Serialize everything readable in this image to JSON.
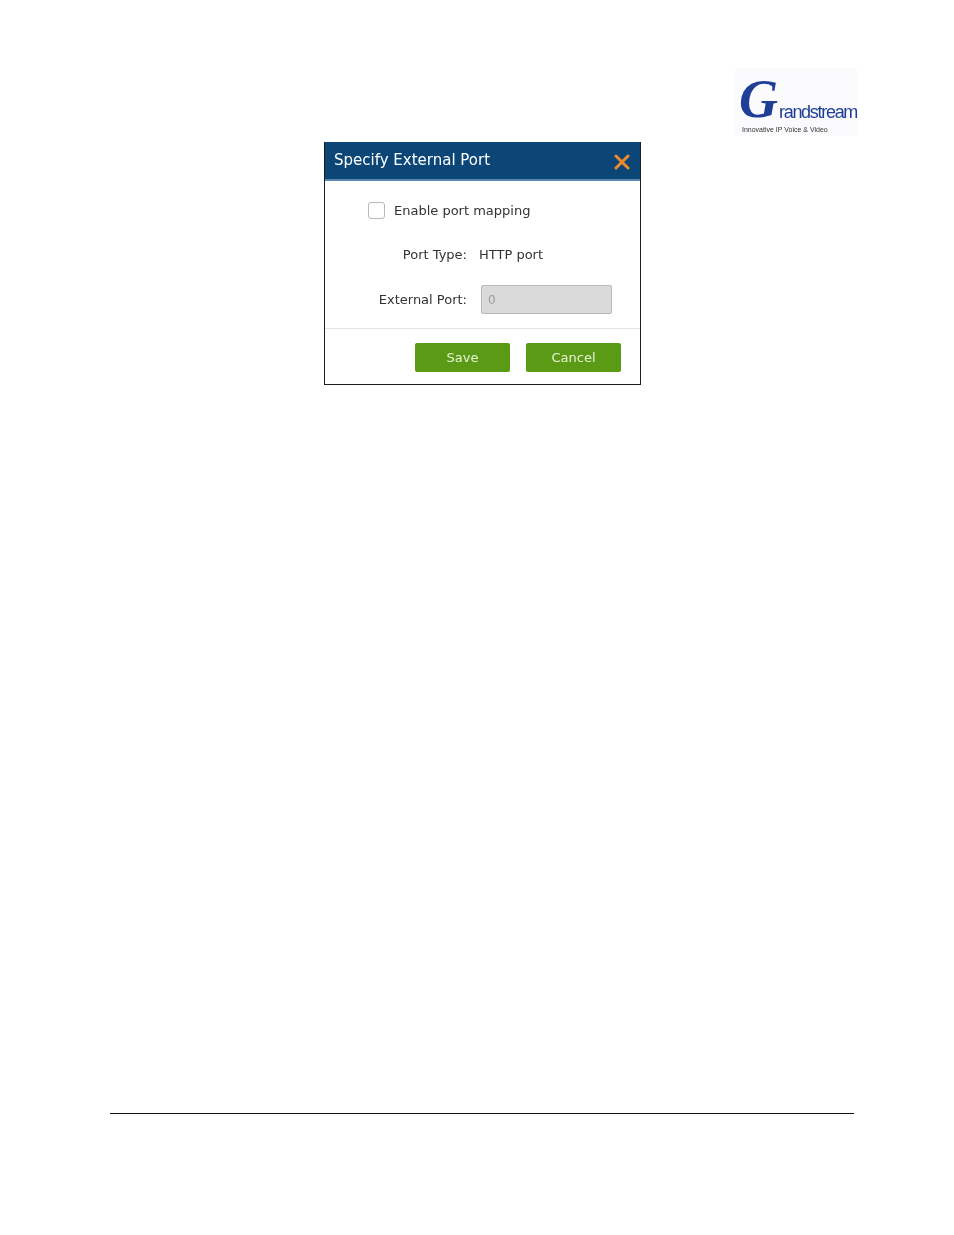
{
  "logo": {
    "initial": "G",
    "name": "randstream",
    "tagline": "Innovative IP Voice & Video"
  },
  "dialog": {
    "title": "Specify External Port",
    "enable_port_mapping": {
      "label": "Enable port mapping",
      "checked": false
    },
    "fields": [
      {
        "kind": "text",
        "label": "Port Type:",
        "value": "HTTP port"
      },
      {
        "kind": "input",
        "label": "External Port:",
        "value": "0",
        "disabled": true
      }
    ],
    "buttons": [
      "Save",
      "Cancel"
    ]
  }
}
